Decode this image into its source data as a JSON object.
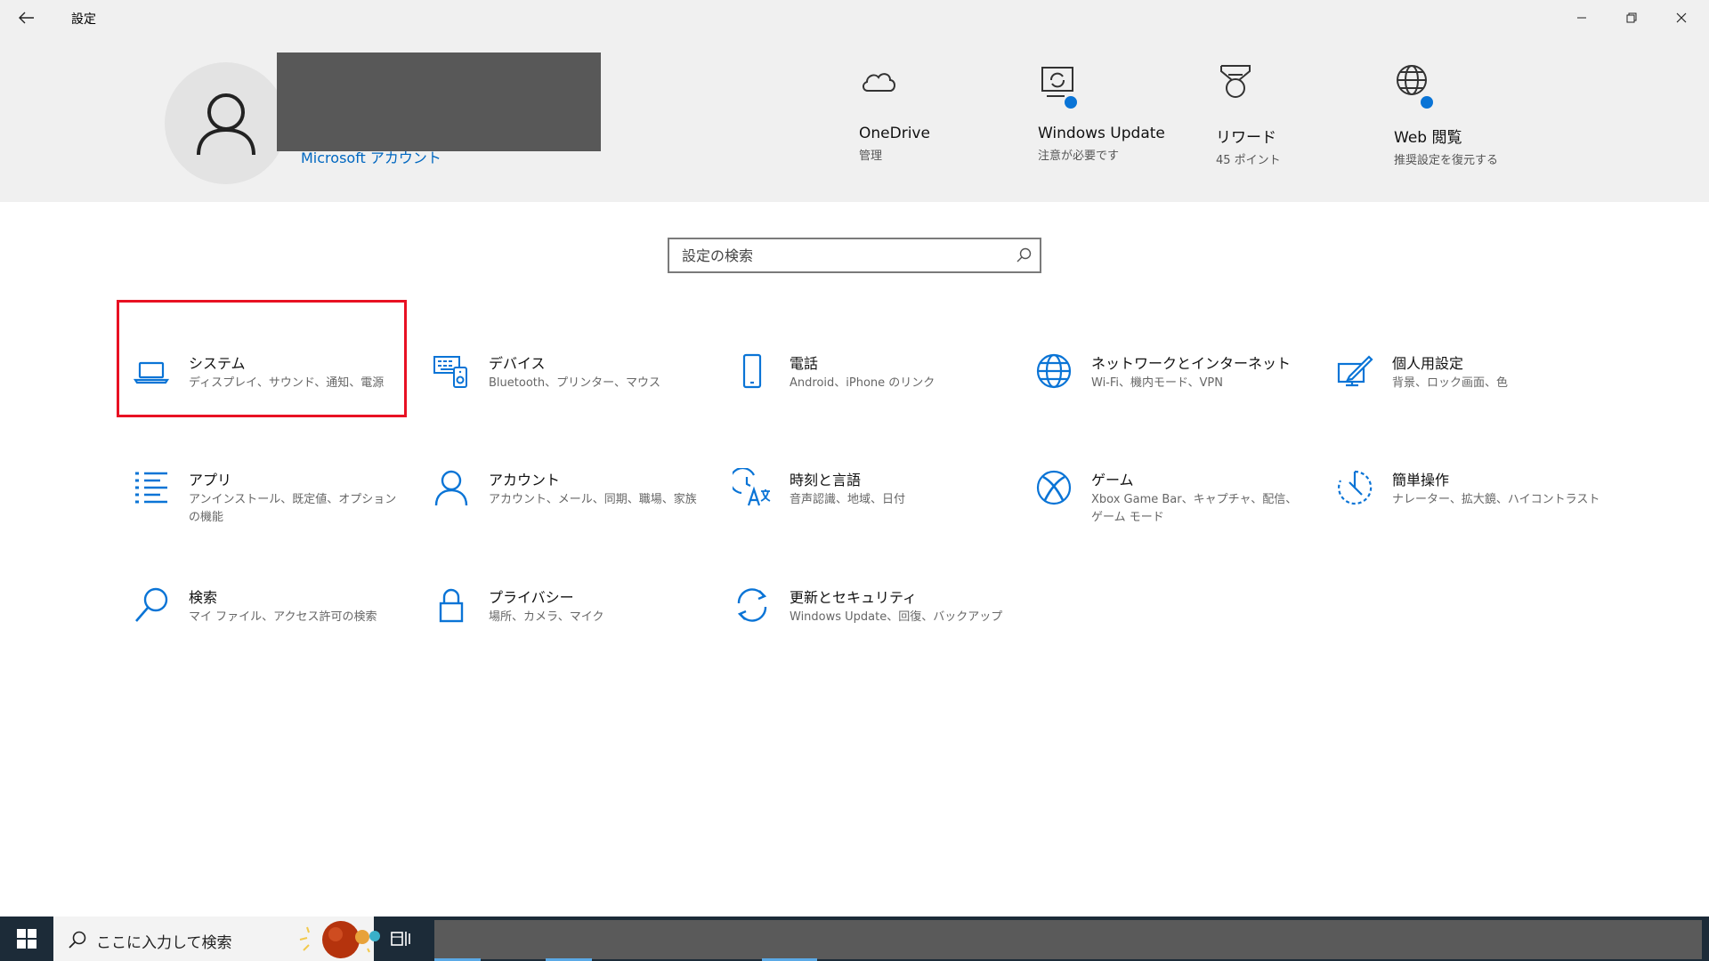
{
  "window": {
    "title": "設定"
  },
  "account": {
    "link_label": "Microsoft アカウント"
  },
  "header_items": [
    {
      "icon": "onedrive-icon",
      "title": "OneDrive",
      "subtitle": "管理"
    },
    {
      "icon": "windows-update-icon",
      "title": "Windows Update",
      "subtitle": "注意が必要です"
    },
    {
      "icon": "rewards-icon",
      "title": "リワード",
      "subtitle": "45 ポイント"
    },
    {
      "icon": "web-browsing-icon",
      "title": "Web 閲覧",
      "subtitle": "推奨設定を復元する"
    }
  ],
  "search": {
    "placeholder": "設定の検索"
  },
  "categories": [
    {
      "icon": "laptop-icon",
      "title": "システム",
      "desc": "ディスプレイ、サウンド、通知、電源"
    },
    {
      "icon": "devices-icon",
      "title": "デバイス",
      "desc": "Bluetooth、プリンター、マウス"
    },
    {
      "icon": "phone-icon",
      "title": "電話",
      "desc": "Android、iPhone のリンク"
    },
    {
      "icon": "globe-icon",
      "title": "ネットワークとインターネット",
      "desc": "Wi-Fi、機内モード、VPN"
    },
    {
      "icon": "personalization-icon",
      "title": "個人用設定",
      "desc": "背景、ロック画面、色"
    },
    {
      "icon": "apps-icon",
      "title": "アプリ",
      "desc": "アンインストール、既定値、オプションの機能"
    },
    {
      "icon": "account-icon",
      "title": "アカウント",
      "desc": "アカウント、メール、同期、職場、家族"
    },
    {
      "icon": "time-language-icon",
      "title": "時刻と言語",
      "desc": "音声認識、地域、日付"
    },
    {
      "icon": "xbox-icon",
      "title": "ゲーム",
      "desc": "Xbox Game Bar、キャプチャ、配信、ゲーム モード"
    },
    {
      "icon": "ease-of-access-icon",
      "title": "簡単操作",
      "desc": "ナレーター、拡大鏡、ハイコントラスト"
    },
    {
      "icon": "search-icon",
      "title": "検索",
      "desc": "マイ ファイル、アクセス許可の検索"
    },
    {
      "icon": "lock-icon",
      "title": "プライバシー",
      "desc": "場所、カメラ、マイク"
    },
    {
      "icon": "update-security-icon",
      "title": "更新とセキュリティ",
      "desc": "Windows Update、回復、バックアップ"
    }
  ],
  "taskbar": {
    "search_placeholder": "ここに入力して検索"
  },
  "colors": {
    "accent": "#0067c0",
    "icon_blue": "#0a74d6",
    "highlight_red": "#e81123",
    "taskbar": "#1c2b38"
  }
}
